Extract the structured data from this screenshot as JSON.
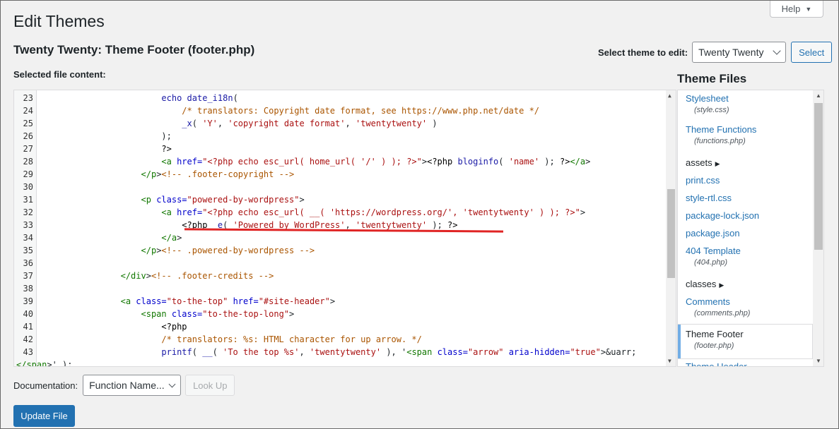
{
  "header": {
    "title": "Edit Themes",
    "help_label": "Help",
    "file_title": "Twenty Twenty: Theme Footer (footer.php)",
    "select_label": "Select theme to edit:",
    "selected_theme": "Twenty Twenty",
    "select_button": "Select",
    "selected_file_label": "Selected file content:"
  },
  "editor": {
    "lines": [
      {
        "n": "23",
        "t": "                        echo date_i18n("
      },
      {
        "n": "24",
        "t": "                            /* translators: Copyright date format, see https://www.php.net/date */"
      },
      {
        "n": "25",
        "t": "                            _x( 'Y', 'copyright date format', 'twentytwenty' )"
      },
      {
        "n": "26",
        "t": "                        );"
      },
      {
        "n": "27",
        "t": "                        ?>"
      },
      {
        "n": "28",
        "t": "                        <a href=\"<?php echo esc_url( home_url( '/' ) ); ?>\"><?php bloginfo( 'name' ); ?></a>"
      },
      {
        "n": "29",
        "t": "                    </p><!-- .footer-copyright -->"
      },
      {
        "n": "30",
        "t": ""
      },
      {
        "n": "31",
        "t": "                    <p class=\"powered-by-wordpress\">"
      },
      {
        "n": "32",
        "t": "                        <a href=\"<?php echo esc_url( __( 'https://wordpress.org/', 'twentytwenty' ) ); ?>\">"
      },
      {
        "n": "33",
        "t": "                            <?php _e( 'Powered by WordPress', 'twentytwenty' ); ?>"
      },
      {
        "n": "34",
        "t": "                        </a>"
      },
      {
        "n": "35",
        "t": "                    </p><!-- .powered-by-wordpress -->"
      },
      {
        "n": "36",
        "t": ""
      },
      {
        "n": "37",
        "t": "                </div><!-- .footer-credits -->"
      },
      {
        "n": "38",
        "t": ""
      },
      {
        "n": "39",
        "t": "                <a class=\"to-the-top\" href=\"#site-header\">"
      },
      {
        "n": "40",
        "t": "                    <span class=\"to-the-top-long\">"
      },
      {
        "n": "41",
        "t": "                        <?php"
      },
      {
        "n": "42",
        "t": "                        /* translators: %s: HTML character for up arrow. */"
      },
      {
        "n": "43",
        "t": "                        printf( __( 'To the top %s', 'twentytwenty' ), '<span class=\"arrow\" aria-hidden=\"true\">&uarr;"
      },
      {
        "n": "",
        "t": "</span>' );"
      }
    ]
  },
  "theme_files": {
    "title": "Theme Files",
    "items": [
      {
        "type": "file",
        "name": "Stylesheet",
        "path": "(style.css)"
      },
      {
        "type": "file",
        "name": "Theme Functions",
        "path": "(functions.php)"
      },
      {
        "type": "folder",
        "name": "assets"
      },
      {
        "type": "file",
        "name": "print.css"
      },
      {
        "type": "file",
        "name": "style-rtl.css"
      },
      {
        "type": "file",
        "name": "package-lock.json"
      },
      {
        "type": "file",
        "name": "package.json"
      },
      {
        "type": "file",
        "name": "404 Template",
        "path": "(404.php)"
      },
      {
        "type": "folder",
        "name": "classes"
      },
      {
        "type": "file",
        "name": "Comments",
        "path": "(comments.php)"
      },
      {
        "type": "file",
        "name": "Theme Footer",
        "path": "(footer.php)",
        "active": true
      },
      {
        "type": "file",
        "name": "Theme Header"
      }
    ]
  },
  "documentation": {
    "label": "Documentation:",
    "select_value": "Function Name...",
    "lookup_button": "Look Up"
  },
  "update_button": "Update File",
  "colors": {
    "primary": "#2271b1",
    "active_border": "#72aee6",
    "underline": "#e02424"
  }
}
